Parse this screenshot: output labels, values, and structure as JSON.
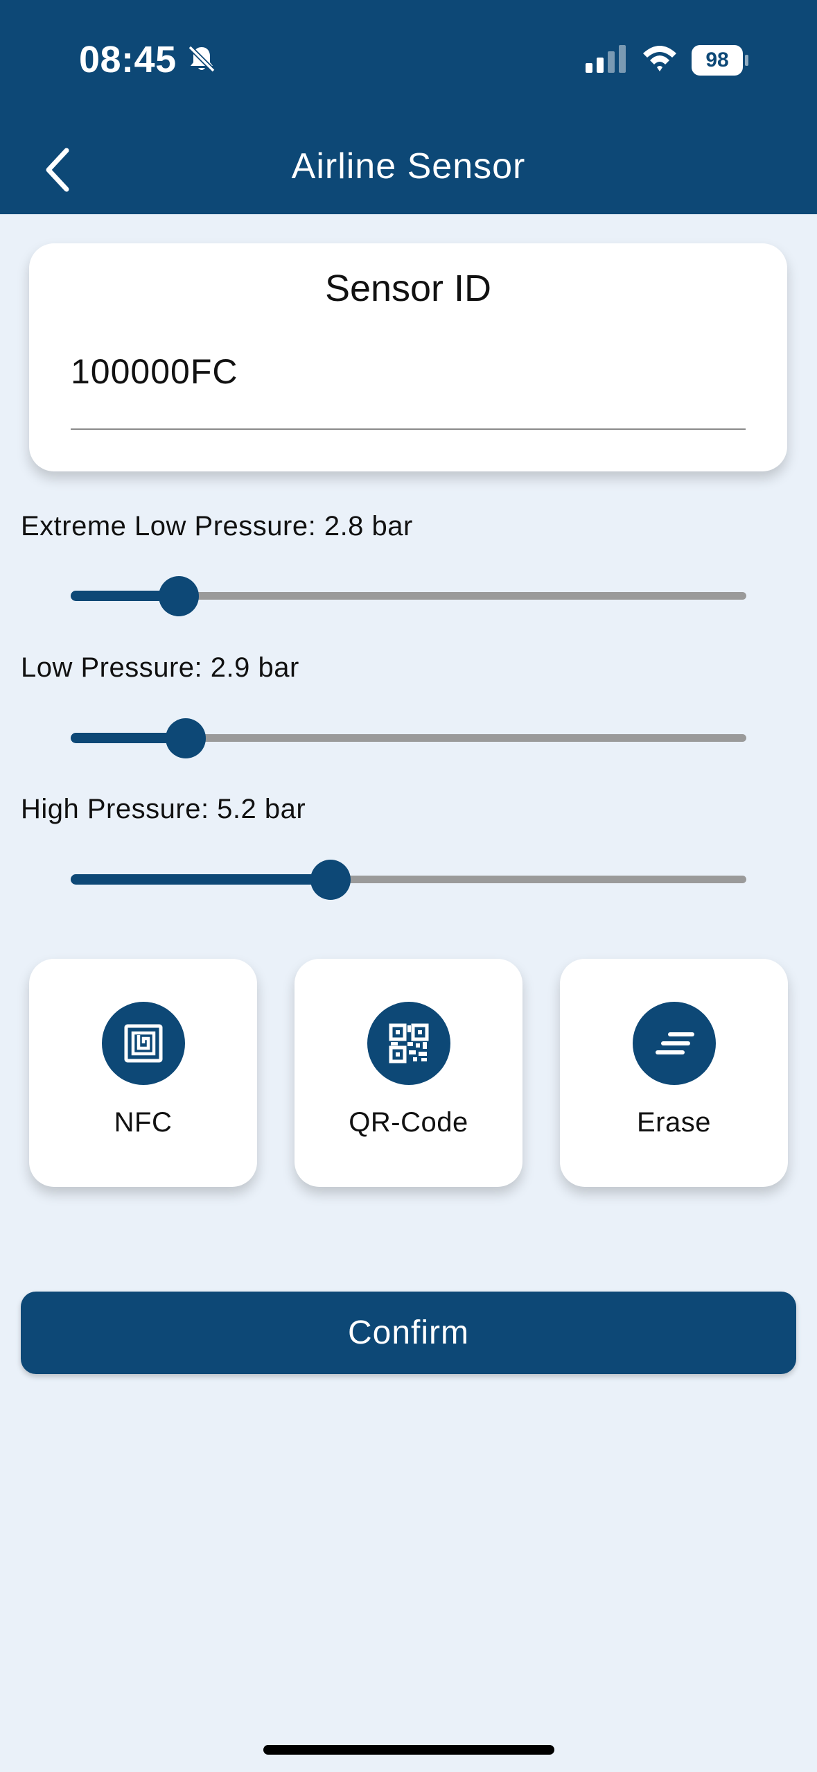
{
  "status_bar": {
    "time": "08:45",
    "battery": "98"
  },
  "header": {
    "title": "Airline Sensor"
  },
  "sensor": {
    "title": "Sensor ID",
    "value": "100000FC"
  },
  "sliders": [
    {
      "label": "Extreme Low Pressure: 2.8 bar",
      "fraction": 0.16
    },
    {
      "label": "Low Pressure: 2.9 bar",
      "fraction": 0.17
    },
    {
      "label": "High Pressure: 5.2 bar",
      "fraction": 0.385
    }
  ],
  "actions": {
    "nfc": {
      "label": "NFC",
      "icon": "nfc-icon"
    },
    "qr": {
      "label": "QR-Code",
      "icon": "qr-code-icon"
    },
    "erase": {
      "label": "Erase",
      "icon": "erase-icon"
    }
  },
  "confirm": {
    "label": "Confirm"
  },
  "colors": {
    "primary": "#0d4876",
    "background": "#eaf1f9",
    "card": "#ffffff",
    "track": "#9a9a9a"
  }
}
